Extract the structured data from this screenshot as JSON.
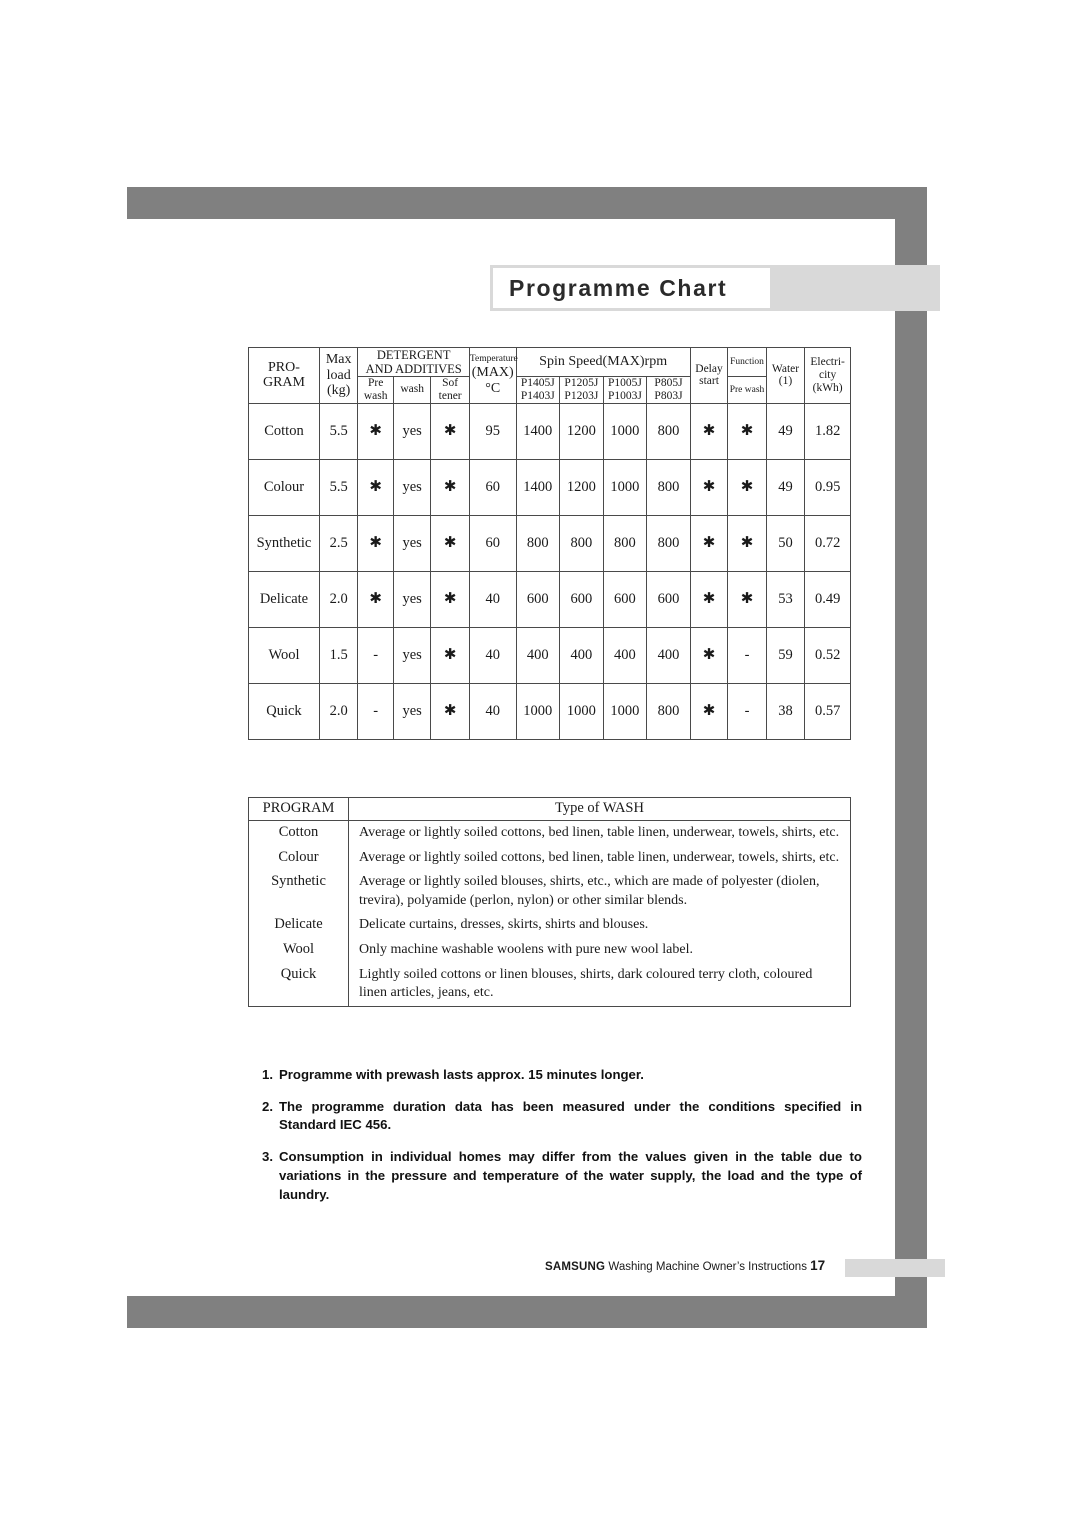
{
  "page": {
    "title": "Programme Chart",
    "frame_color": "#808080",
    "band_color": "#d9d9d9"
  },
  "spec_table": {
    "headers": {
      "program": "PRO-\nGRAM",
      "program_line1": "PRO-",
      "program_line2": "GRAM",
      "max_load_line1": "Max",
      "max_load_line2": "load",
      "max_load_line3": "(kg)",
      "detergent_line1": "DETERGENT",
      "detergent_line2": "AND ADDITIVES",
      "pre_wash_line1": "Pre",
      "pre_wash_line2": "wash",
      "wash": "wash",
      "softener_line1": "Sof",
      "softener_line2": "tener",
      "temperature_line1": "Temperature",
      "temperature_line2": "(MAX)",
      "temperature_line3": "°C",
      "spin_speed": "Spin Speed(MAX)rpm",
      "spin_cols": [
        {
          "line1": "P1405J",
          "line2": "P1403J"
        },
        {
          "line1": "P1205J",
          "line2": "P1203J"
        },
        {
          "line1": "P1005J",
          "line2": "P1003J"
        },
        {
          "line1": "P805J",
          "line2": "P803J"
        }
      ],
      "delay_line1": "Delay",
      "delay_line2": "start",
      "function": "Function",
      "function_pre_wash": "Pre wash",
      "water_line1": "Water",
      "water_line2": "(1)",
      "electricity_line1": "Electri-",
      "electricity_line2": "city",
      "electricity_line3": "(kWh)"
    },
    "rows": [
      {
        "program": "Cotton",
        "max_load": "5.5",
        "pre_wash": "✱",
        "wash": "yes",
        "softener": "✱",
        "temperature": "95",
        "spin": [
          "1400",
          "1200",
          "1000",
          "800"
        ],
        "delay_start": "✱",
        "function_pre_wash": "✱",
        "water": "49",
        "electricity": "1.82"
      },
      {
        "program": "Colour",
        "max_load": "5.5",
        "pre_wash": "✱",
        "wash": "yes",
        "softener": "✱",
        "temperature": "60",
        "spin": [
          "1400",
          "1200",
          "1000",
          "800"
        ],
        "delay_start": "✱",
        "function_pre_wash": "✱",
        "water": "49",
        "electricity": "0.95"
      },
      {
        "program": "Synthetic",
        "max_load": "2.5",
        "pre_wash": "✱",
        "wash": "yes",
        "softener": "✱",
        "temperature": "60",
        "spin": [
          "800",
          "800",
          "800",
          "800"
        ],
        "delay_start": "✱",
        "function_pre_wash": "✱",
        "water": "50",
        "electricity": "0.72"
      },
      {
        "program": "Delicate",
        "max_load": "2.0",
        "pre_wash": "✱",
        "wash": "yes",
        "softener": "✱",
        "temperature": "40",
        "spin": [
          "600",
          "600",
          "600",
          "600"
        ],
        "delay_start": "✱",
        "function_pre_wash": "✱",
        "water": "53",
        "electricity": "0.49"
      },
      {
        "program": "Wool",
        "max_load": "1.5",
        "pre_wash": "-",
        "wash": "yes",
        "softener": "✱",
        "temperature": "40",
        "spin": [
          "400",
          "400",
          "400",
          "400"
        ],
        "delay_start": "✱",
        "function_pre_wash": "-",
        "water": "59",
        "electricity": "0.52"
      },
      {
        "program": "Quick",
        "max_load": "2.0",
        "pre_wash": "-",
        "wash": "yes",
        "softener": "✱",
        "temperature": "40",
        "spin": [
          "1000",
          "1000",
          "1000",
          "800"
        ],
        "delay_start": "✱",
        "function_pre_wash": "-",
        "water": "38",
        "electricity": "0.57"
      }
    ]
  },
  "wash_table": {
    "header": {
      "program": "PROGRAM",
      "type": "Type of  WASH"
    },
    "rows": [
      {
        "program": "Cotton",
        "description": "Average or lightly soiled cottons, bed linen, table linen, underwear, towels, shirts, etc."
      },
      {
        "program": "Colour",
        "description": "Average or lightly soiled cottons, bed linen, table linen, underwear, towels, shirts, etc."
      },
      {
        "program": "Synthetic",
        "description": "Average or lightly soiled blouses, shirts, etc., which are made of polyester (diolen, trevira), polyamide (perlon, nylon) or other similar blends."
      },
      {
        "program": "Delicate",
        "description": "Delicate curtains, dresses, skirts, shirts and blouses."
      },
      {
        "program": "Wool",
        "description": "Only machine washable woolens with pure new wool label."
      },
      {
        "program": "Quick",
        "description": "Lightly soiled cottons or linen blouses, shirts, dark coloured terry cloth, coloured linen articles, jeans, etc."
      }
    ]
  },
  "notes": [
    {
      "num": "1.",
      "text": "Programme with prewash lasts approx. 15 minutes longer."
    },
    {
      "num": "2.",
      "text": "The programme duration data has been measured under the conditions specified in Standard IEC 456."
    },
    {
      "num": "3.",
      "text": "Consumption in individual homes may differ from the values given in the table due to variations in the pressure and temperature of the water supply, the load and the type of laundry."
    }
  ],
  "footer": {
    "brand": "SAMSUNG",
    "document": "Washing Machine Owner’s Instructions",
    "page_number": "17"
  }
}
